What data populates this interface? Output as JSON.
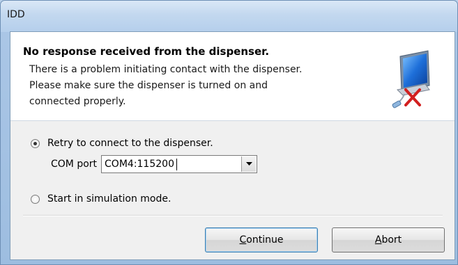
{
  "window": {
    "title": "IDD"
  },
  "header": {
    "title": "No response received from the dispenser.",
    "line1": "There is a problem initiating contact with the dispenser.",
    "line2": "Please make sure the dispenser is turned on and",
    "line3": "connected properly.",
    "icon": "computer-disconnected-icon"
  },
  "options": {
    "retry_label": "Retry to connect to the dispenser.",
    "retry_selected": true,
    "com_port_label": "COM port",
    "com_port_value": "COM4:115200",
    "simulation_label": "Start in simulation mode.",
    "simulation_selected": false
  },
  "buttons": {
    "continue_label": "Continue",
    "abort_label": "Abort"
  }
}
